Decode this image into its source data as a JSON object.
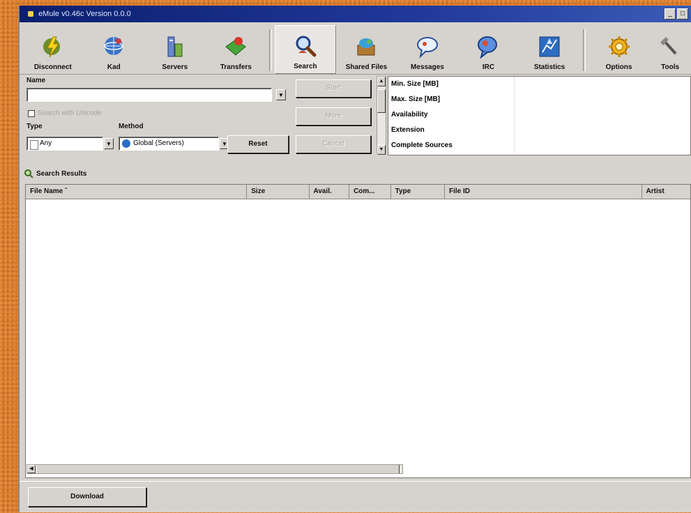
{
  "window": {
    "title": "eMule v0.46c Version 0.0.0"
  },
  "toolbar": {
    "buttons": [
      {
        "id": "disconnect",
        "label": "Disconnect",
        "icon": "lightning-icon"
      },
      {
        "id": "kad",
        "label": "Kad",
        "icon": "kad-globe-icon"
      },
      {
        "id": "servers",
        "label": "Servers",
        "icon": "server-icon"
      },
      {
        "id": "transfers",
        "label": "Transfers",
        "icon": "transfers-icon"
      },
      {
        "id": "search",
        "label": "Search",
        "icon": "search-magnifier-icon"
      },
      {
        "id": "shared",
        "label": "Shared Files",
        "icon": "shared-files-icon"
      },
      {
        "id": "messages",
        "label": "Messages",
        "icon": "messages-icon"
      },
      {
        "id": "irc",
        "label": "IRC",
        "icon": "irc-icon"
      },
      {
        "id": "statistics",
        "label": "Statistics",
        "icon": "statistics-icon"
      },
      {
        "id": "options",
        "label": "Options",
        "icon": "options-gear-icon"
      },
      {
        "id": "tools",
        "label": "Tools",
        "icon": "tools-icon"
      }
    ],
    "active": "search"
  },
  "search": {
    "name_label": "Name",
    "name_value": "",
    "checkbox_label": "Search with Unicode",
    "type_label": "Type",
    "type_value": "Any",
    "method_label": "Method",
    "method_value": "Global (Servers)",
    "reset_label": "Reset",
    "start_label": "Start",
    "more_label": "More",
    "cancel_label": "Cancel",
    "properties": [
      "Min. Size [MB]",
      "Max. Size [MB]",
      "Availability",
      "Extension",
      "Complete Sources"
    ]
  },
  "results": {
    "header": "Search Results",
    "columns": [
      "File Name",
      "Size",
      "Avail.",
      "Com...",
      "Type",
      "File ID",
      "Artist"
    ]
  },
  "footer": {
    "download_label": "Download"
  }
}
